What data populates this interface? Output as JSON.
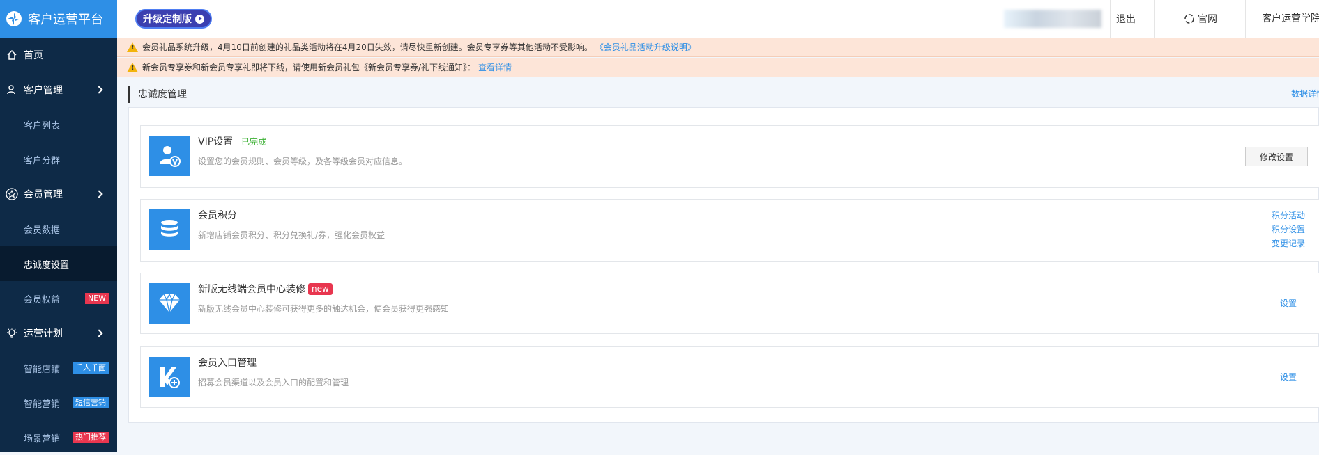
{
  "sidebar": {
    "logo_text": "客户运营平台",
    "items": [
      {
        "label": "首页",
        "type": "top",
        "icon": "home-icon"
      },
      {
        "label": "客户管理",
        "type": "top",
        "icon": "user-icon",
        "expand": true
      },
      {
        "label": "客户列表",
        "type": "sub"
      },
      {
        "label": "客户分群",
        "type": "sub"
      },
      {
        "label": "会员管理",
        "type": "top",
        "icon": "star-icon",
        "expand": true
      },
      {
        "label": "会员数据",
        "type": "sub"
      },
      {
        "label": "忠诚度设置",
        "type": "sub",
        "active": true
      },
      {
        "label": "会员权益",
        "type": "sub",
        "tag": "NEW"
      },
      {
        "label": "运营计划",
        "type": "top",
        "icon": "bulb-icon",
        "expand": true
      },
      {
        "label": "智能店铺",
        "type": "sub",
        "tag": "千人千面"
      },
      {
        "label": "智能营销",
        "type": "sub",
        "tag": "短信营销"
      },
      {
        "label": "场景营销",
        "type": "sub",
        "tag": "热门推荐"
      }
    ]
  },
  "header": {
    "upgrade_label": "升级定制版",
    "logout": "退出",
    "official": "官网",
    "academy": "客户运营学院"
  },
  "notices": [
    {
      "text": "会员礼品系统升级，4月10日前创建的礼品类活动将在4月20日失效，请尽快重新创建。会员专享券等其他活动不受影响。",
      "link": "《会员礼品活动升级说明》"
    },
    {
      "text": "新会员专享券和新会员专享礼即将下线，请使用新会员礼包《新会员专享券/礼下线通知》：",
      "link": "查看详情"
    }
  ],
  "main": {
    "section_title": "忠诚度管理",
    "data_detail": "数据详情",
    "cards": [
      {
        "title": "VIP设置",
        "status": "已完成",
        "desc": "设置您的会员规则、会员等级，及各等级会员对应信息。",
        "button": "修改设置",
        "icon": "vip-user-icon"
      },
      {
        "title": "会员积分",
        "desc": "新增店铺会员积分、积分兑换礼/券，强化会员权益",
        "links": [
          "积分活动",
          "积分设置",
          "变更记录"
        ],
        "icon": "points-coin-icon"
      },
      {
        "title": "新版无线端会员中心装修",
        "badge": "new",
        "desc": "新版无线会员中心装修可获得更多的触达机会，便会员获得更强感知",
        "links": [
          "设置"
        ],
        "icon": "diamond-icon"
      },
      {
        "title": "会员入口管理",
        "desc": "招募会员渠道以及会员入口的配置和管理",
        "links": [
          "设置"
        ],
        "icon": "entry-icon"
      }
    ]
  },
  "colors": {
    "sidebar_bg": "#0e2a47",
    "accent": "#2e8fe6",
    "notice_bg": "#fde5d8",
    "success": "#3cb034",
    "danger": "#e8364f"
  }
}
